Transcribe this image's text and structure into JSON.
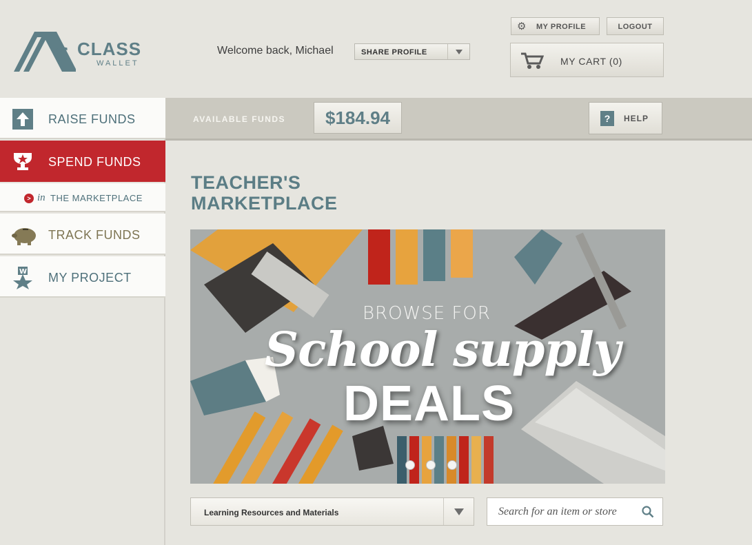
{
  "brand": {
    "name_line1": "CLASS",
    "name_line2": "WALLET",
    "accent": "#5f7f87",
    "red": "#c1272d"
  },
  "header": {
    "welcome": "Welcome back, Michael",
    "share_select": {
      "value": "SHARE PROFILE"
    },
    "my_profile": "MY PROFILE",
    "logout": "LOGOUT",
    "cart": "MY CART (0)"
  },
  "funds": {
    "label": "AVAILABLE FUNDS",
    "amount": "$184.94",
    "help": "HELP"
  },
  "sidebar": {
    "items": [
      {
        "label": "RAISE FUNDS",
        "icon": "upload-arrow-icon"
      },
      {
        "label": "SPEND FUNDS",
        "icon": "trophy-icon"
      },
      {
        "label": "TRACK FUNDS",
        "icon": "piggy-bank-icon"
      },
      {
        "label": "MY PROJECT",
        "icon": "ribbon-star-icon"
      }
    ],
    "sub": {
      "prefix": "in",
      "label": "THE MARKETPLACE"
    }
  },
  "main": {
    "title_line1": "TEACHER'S",
    "title_line2": "MARKETPLACE",
    "banner": {
      "line1": "BROWSE FOR",
      "line2": "School supply",
      "line3": "DEALS",
      "slides": 3
    },
    "category_select": {
      "value": "Learning Resources and Materials"
    },
    "search": {
      "placeholder": "Search for an item or store"
    }
  }
}
